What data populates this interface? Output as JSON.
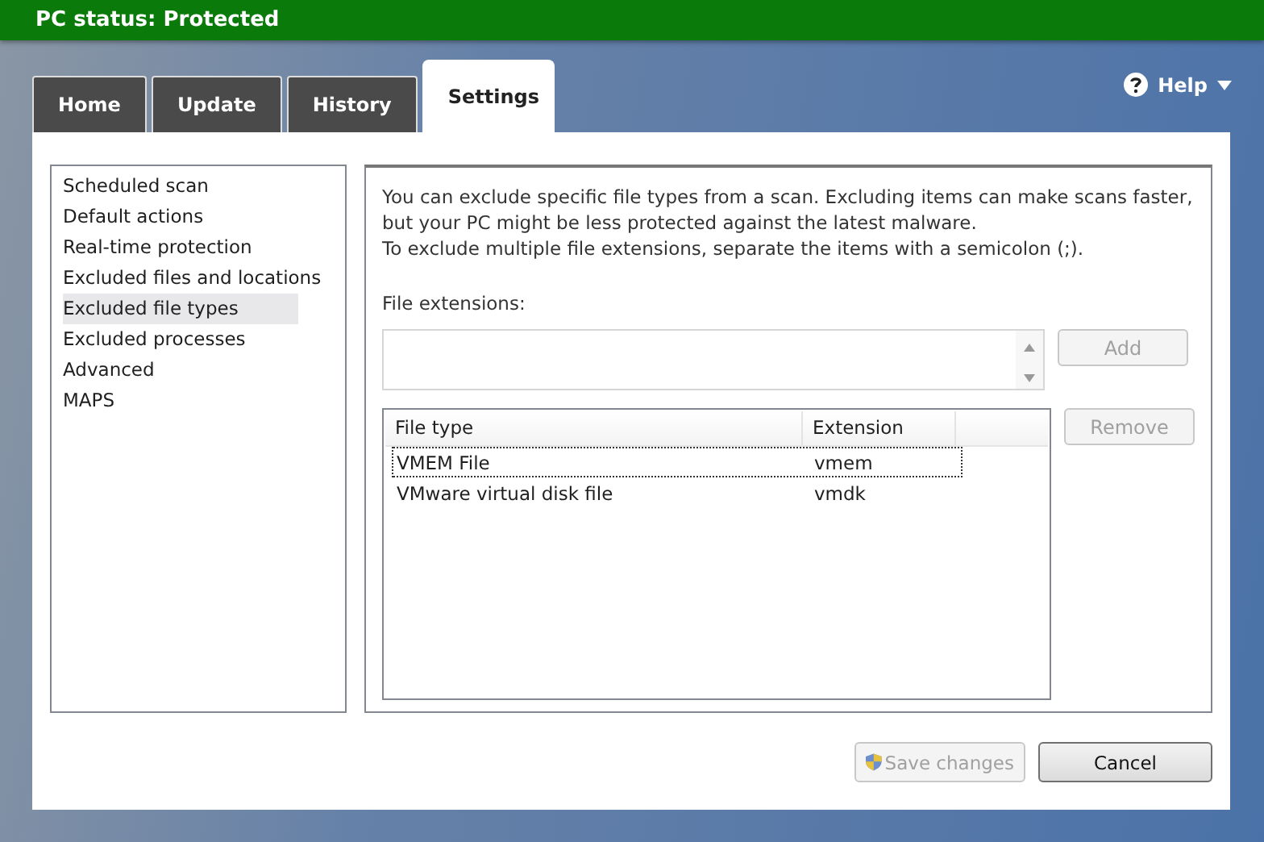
{
  "status_bar": {
    "title": "PC status: Protected"
  },
  "tabs": [
    {
      "label": "Home",
      "selected": false
    },
    {
      "label": "Update",
      "selected": false
    },
    {
      "label": "History",
      "selected": false
    },
    {
      "label": "Settings",
      "selected": true
    }
  ],
  "help": {
    "label": "Help"
  },
  "sidebar": {
    "items": [
      {
        "label": "Scheduled scan",
        "selected": false
      },
      {
        "label": "Default actions",
        "selected": false
      },
      {
        "label": "Real-time protection",
        "selected": false
      },
      {
        "label": "Excluded files and locations",
        "selected": false
      },
      {
        "label": "Excluded file types",
        "selected": true
      },
      {
        "label": "Excluded processes",
        "selected": false
      },
      {
        "label": "Advanced",
        "selected": false
      },
      {
        "label": "MAPS",
        "selected": false
      }
    ]
  },
  "description": [
    "You can exclude specific file types from a scan. Excluding items can make scans faster, but your PC might be less protected against the latest malware.",
    "To exclude multiple file extensions, separate the items with a semicolon (;)."
  ],
  "extensions_field": {
    "label": "File extensions:"
  },
  "add_button": {
    "label": "Add",
    "disabled": true
  },
  "remove_button": {
    "label": "Remove",
    "disabled": true
  },
  "table": {
    "columns": [
      "File type",
      "Extension"
    ],
    "rows": [
      {
        "cells": [
          "VMEM File",
          "vmem"
        ],
        "focused": true
      },
      {
        "cells": [
          "VMware virtual disk file",
          "vmdk"
        ],
        "focused": false
      }
    ]
  },
  "footer_buttons": [
    {
      "label": "Save changes",
      "kind": "shield",
      "disabled": true
    },
    {
      "label": "Cancel",
      "kind": "plain",
      "disabled": false
    }
  ]
}
